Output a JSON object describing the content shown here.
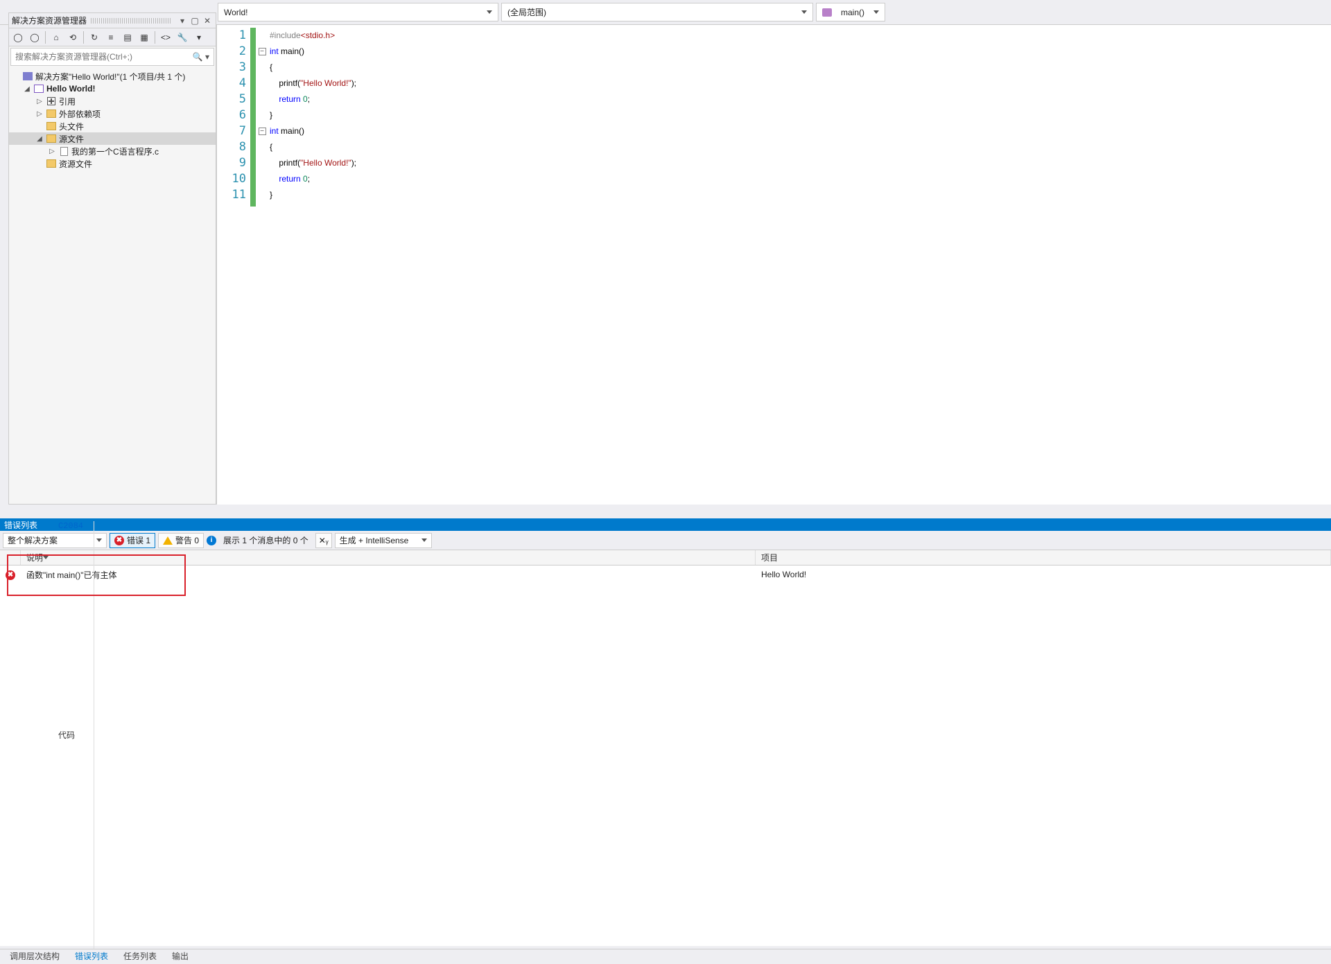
{
  "crumbs": {
    "file": "World!",
    "scope": "(全局范围)",
    "func": "main()"
  },
  "solutionExplorer": {
    "title": "解决方案资源管理器",
    "searchPlaceholder": "搜索解决方案资源管理器(Ctrl+;)",
    "tree": {
      "solution": "解决方案\"Hello World!\"(1 个项目/共 1 个)",
      "project": "Hello World!",
      "refs": "引用",
      "ext": "外部依赖项",
      "headers": "头文件",
      "source": "源文件",
      "srcfile": "我的第一个C语言程序.c",
      "res": "资源文件"
    }
  },
  "code": {
    "lines": [
      {
        "n": 1,
        "fold": "",
        "html": "<span class='k-pre'>#include</span><span class='k-inc'>&lt;stdio.h&gt;</span>"
      },
      {
        "n": 2,
        "fold": "-",
        "html": "<span class='k-kw'>int</span> <span class='k-pn'>main()</span>"
      },
      {
        "n": 3,
        "fold": "",
        "html": "<span class='k-pn'>{</span>"
      },
      {
        "n": 4,
        "fold": "",
        "html": "    <span class='k-pn'>printf(</span><span class='k-str'>\"Hello World!\"</span><span class='k-pn'>);</span>"
      },
      {
        "n": 5,
        "fold": "",
        "html": "    <span class='k-kw'>return</span> <span class='k-num'>0</span><span class='k-pn'>;</span>"
      },
      {
        "n": 6,
        "fold": "",
        "html": "<span class='k-pn'>}</span>"
      },
      {
        "n": 7,
        "fold": "-",
        "html": "<span class='k-kw'>int</span> <span class='k-pn'>main()</span>"
      },
      {
        "n": 8,
        "fold": "",
        "html": "<span class='k-pn'>{</span>"
      },
      {
        "n": 9,
        "fold": "",
        "html": "    <span class='k-pn'>printf(</span><span class='k-str'>\"Hello World!\"</span><span class='k-pn'>);</span>"
      },
      {
        "n": 10,
        "fold": "",
        "html": "    <span class='k-kw'>return</span> <span class='k-num'>0</span><span class='k-pn'>;</span>"
      },
      {
        "n": 11,
        "fold": "",
        "html": "<span class='k-pn'>}</span>"
      }
    ]
  },
  "errorList": {
    "title": "错误列表",
    "scopeCombo": "整个解决方案",
    "errBtn": "错误 1",
    "warnBtn": "警告 0",
    "infoMsg": "展示 1 个消息中的 0 个",
    "buildCombo": "生成 + IntelliSense",
    "cols": {
      "code": "代码",
      "desc": "说明",
      "proj": "项目"
    },
    "rows": [
      {
        "code": "C2084",
        "desc": "函数\"int main()\"已有主体",
        "proj": "Hello World!"
      }
    ]
  },
  "bottomTabs": {
    "t1": "调用层次结构",
    "t2": "错误列表",
    "t3": "任务列表",
    "t4": "输出"
  }
}
